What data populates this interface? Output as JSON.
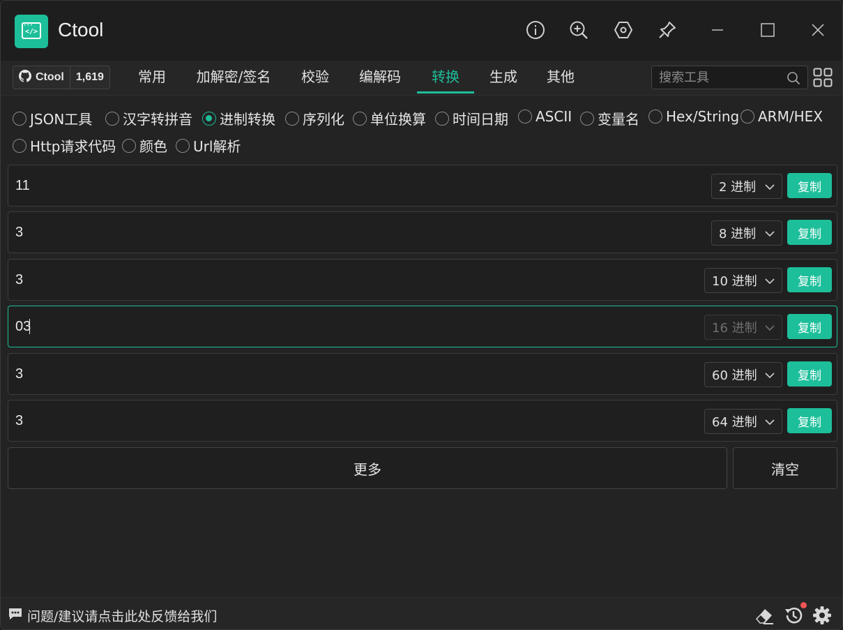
{
  "app": {
    "title": "Ctool",
    "accent": "#1dbf9a"
  },
  "titlebar": {
    "icons": [
      "info-icon",
      "zoom-in-icon",
      "settings-hex-icon",
      "pin-icon",
      "minimize-icon",
      "maximize-icon",
      "close-icon"
    ]
  },
  "github": {
    "label": "Ctool",
    "stars": "1,619"
  },
  "tabs": [
    {
      "label": "常用"
    },
    {
      "label": "加解密/签名"
    },
    {
      "label": "校验"
    },
    {
      "label": "编解码"
    },
    {
      "label": "转换",
      "active": true
    },
    {
      "label": "生成"
    },
    {
      "label": "其他"
    }
  ],
  "search": {
    "placeholder": "搜索工具"
  },
  "tools": [
    {
      "label": "JSON工具"
    },
    {
      "label": "汉字转拼音"
    },
    {
      "label": "进制转换",
      "checked": true
    },
    {
      "label": "序列化"
    },
    {
      "label": "单位换算"
    },
    {
      "label": "时间日期"
    },
    {
      "label": "ASCII"
    },
    {
      "label": "变量名"
    },
    {
      "label": "Hex/String"
    },
    {
      "label": "ARM/HEX"
    },
    {
      "label": "Http请求代码"
    },
    {
      "label": "颜色"
    },
    {
      "label": "Url解析"
    }
  ],
  "rows": [
    {
      "value": "11",
      "base": "2 进制",
      "copy": "复制"
    },
    {
      "value": "3",
      "base": "8 进制",
      "copy": "复制"
    },
    {
      "value": "3",
      "base": "10 进制",
      "copy": "复制"
    },
    {
      "value": "03",
      "base": "16 进制",
      "copy": "复制",
      "focused": true
    },
    {
      "value": "3",
      "base": "60 进制",
      "copy": "复制"
    },
    {
      "value": "3",
      "base": "64 进制",
      "copy": "复制"
    }
  ],
  "actions": {
    "more": "更多",
    "clear": "清空"
  },
  "footer": {
    "feedback": "问题/建议请点击此处反馈给我们",
    "icons": [
      "eraser-icon",
      "history-icon",
      "gear-icon"
    ]
  }
}
